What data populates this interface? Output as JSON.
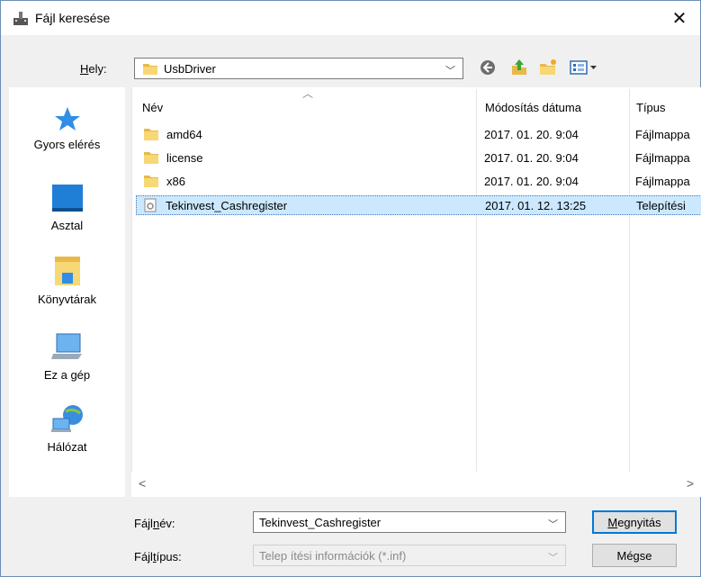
{
  "window": {
    "title": "Fájl keresése",
    "close_glyph": "✕"
  },
  "location": {
    "label_prefix": "H",
    "label_rest": "ely:",
    "value": "UsbDriver"
  },
  "toolbar": {
    "back_icon": "back-icon",
    "up_icon": "up-folder-icon",
    "newfolder_icon": "new-folder-icon",
    "view_icon": "view-menu-icon"
  },
  "places": [
    {
      "label": "Gyors elérés",
      "icon": "star-icon"
    },
    {
      "label": "Asztal",
      "icon": "desktop-icon"
    },
    {
      "label": "Könyvtárak",
      "icon": "libraries-icon"
    },
    {
      "label": "Ez a gép",
      "icon": "computer-icon"
    },
    {
      "label": "Hálózat",
      "icon": "network-icon"
    }
  ],
  "columns": {
    "name": "Név",
    "modified": "Módosítás dátuma",
    "type": "Típus"
  },
  "files": [
    {
      "name": "amd64",
      "modified": "2017. 01. 20. 9:04",
      "type": "Fájlmappa",
      "kind": "folder"
    },
    {
      "name": "license",
      "modified": "2017. 01. 20. 9:04",
      "type": "Fájlmappa",
      "kind": "folder"
    },
    {
      "name": "x86",
      "modified": "2017. 01. 20. 9:04",
      "type": "Fájlmappa",
      "kind": "folder"
    },
    {
      "name": "Tekinvest_Cashregister",
      "modified": "2017. 01. 12. 13:25",
      "type": "Telepítési",
      "kind": "inf"
    }
  ],
  "scroll": {
    "left": "<",
    "right": ">"
  },
  "filename": {
    "label_pre": "Fájl",
    "label_u": "n",
    "label_post": "év:",
    "value": "Tekinvest_Cashregister"
  },
  "filetype": {
    "label_pre": "Fájl",
    "label_u": "t",
    "label_post": "ípus:",
    "value": "Telep ítési információk (*.inf)"
  },
  "buttons": {
    "open_u": "M",
    "open_rest": "egnyitás",
    "cancel": "Mégse"
  },
  "colors": {
    "selection": "#cce8ff",
    "accent": "#0078d7",
    "folder": "#f8d775"
  }
}
